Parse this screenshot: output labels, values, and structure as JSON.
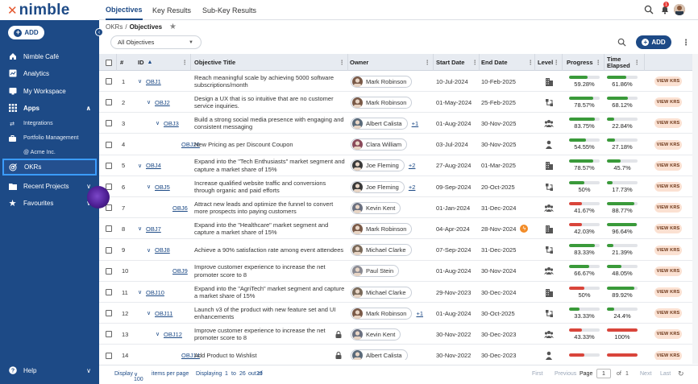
{
  "brand": {
    "name": "nimble"
  },
  "sidebar": {
    "add_label": "ADD",
    "items": [
      {
        "label": "Nimble Café"
      },
      {
        "label": "Analytics"
      },
      {
        "label": "My Workspace"
      },
      {
        "label": "Apps"
      }
    ],
    "apps": [
      {
        "label": "Integrations"
      },
      {
        "label": "Portfolio Management"
      },
      {
        "label": "@ Acme Inc."
      },
      {
        "label": "OKRs"
      }
    ],
    "recent": "Recent Projects",
    "favourites": "Favourites",
    "help": "Help"
  },
  "topbar": {
    "tabs": [
      {
        "label": "Objectives"
      },
      {
        "label": "Key Results"
      },
      {
        "label": "Sub-Key Results"
      }
    ],
    "notification_count": "1"
  },
  "breadcrumb": {
    "parent": "OKRs",
    "separator": "/",
    "current": "Objectives"
  },
  "toolbar": {
    "filter_value": "All Objectives",
    "add_label": "ADD"
  },
  "table": {
    "headers": {
      "num": "#",
      "id": "ID",
      "title": "Objective Title",
      "owner": "Owner",
      "start": "Start Date",
      "end": "End Date",
      "level": "Level",
      "progress": "Progress",
      "time": "Time Elapsed"
    },
    "action_label": "VIEW KRS",
    "rows": [
      {
        "num": "1",
        "id": "OBJ1",
        "indent": 1,
        "toggle": "∨",
        "title": "Reach meaningful scale by achieving 5000 software subscriptions/month",
        "owner": "Mark Robinson",
        "more": "",
        "start": "10-Jul-2024",
        "end": "10-Feb-2025",
        "level": "building",
        "progress": "59.28%",
        "progress_value": 0.5928,
        "progress_color": "#3a9a3a",
        "time": "61.86%",
        "time_value": 0.6186,
        "time_color": "#3a9a3a",
        "lock": false,
        "flame": false
      },
      {
        "num": "2",
        "id": "OBJ2",
        "indent": 2,
        "toggle": "∨",
        "title": "Design a UX that is so intuitive that are no customer service inquiries.",
        "owner": "Mark Robinson",
        "more": "",
        "start": "01-May-2024",
        "end": "25-Feb-2025",
        "level": "hierarchy",
        "progress": "78.57%",
        "progress_value": 0.7857,
        "progress_color": "#3a9a3a",
        "time": "68.12%",
        "time_value": 0.6812,
        "time_color": "#3a9a3a",
        "lock": false,
        "flame": false
      },
      {
        "num": "3",
        "id": "OBJ3",
        "indent": 3,
        "toggle": "∨",
        "title": "Build a strong social media presence with engaging and consistent messaging",
        "owner": "Albert Calista",
        "more": "+1",
        "start": "01-Aug-2024",
        "end": "30-Nov-2025",
        "level": "team",
        "progress": "83.75%",
        "progress_value": 0.8375,
        "progress_color": "#3a9a3a",
        "time": "22.84%",
        "time_value": 0.2284,
        "time_color": "#3a9a3a",
        "lock": false,
        "flame": false
      },
      {
        "num": "4",
        "id": "OBJ26",
        "indent": 4,
        "toggle": "",
        "title": "New Pricing as per Discount Coupon",
        "owner": "Clara William",
        "more": "",
        "start": "03-Jul-2024",
        "end": "30-Nov-2025",
        "level": "person",
        "progress": "54.55%",
        "progress_value": 0.5455,
        "progress_color": "#3a9a3a",
        "time": "27.18%",
        "time_value": 0.2718,
        "time_color": "#3a9a3a",
        "lock": false,
        "flame": false
      },
      {
        "num": "5",
        "id": "OBJ4",
        "indent": 1,
        "toggle": "∨",
        "title": "Expand into the \"Tech Enthusiasts\" market segment and capture a market share of 15%",
        "owner": "Joe Fleming",
        "more": "+2",
        "start": "27-Aug-2024",
        "end": "01-Mar-2025",
        "level": "building",
        "progress": "78.57%",
        "progress_value": 0.7857,
        "progress_color": "#3a9a3a",
        "time": "45.7%",
        "time_value": 0.457,
        "time_color": "#3a9a3a",
        "lock": false,
        "flame": false
      },
      {
        "num": "6",
        "id": "OBJ5",
        "indent": 2,
        "toggle": "∨",
        "title": "Increase qualified website traffic and conversions through organic and paid efforts",
        "owner": "Joe Fleming",
        "more": "+2",
        "start": "09-Sep-2024",
        "end": "20-Oct-2025",
        "level": "hierarchy",
        "progress": "50%",
        "progress_value": 0.5,
        "progress_color": "#3a9a3a",
        "time": "17.73%",
        "time_value": 0.1773,
        "time_color": "#3a9a3a",
        "lock": false,
        "flame": false
      },
      {
        "num": "7",
        "id": "OBJ6",
        "indent": 3,
        "toggle": "",
        "title": "Attract new leads and optimize the funnel to convert more prospects into paying customers",
        "owner": "Kevin Kent",
        "more": "",
        "start": "01-Jan-2024",
        "end": "31-Dec-2024",
        "level": "team",
        "progress": "41.67%",
        "progress_value": 0.4167,
        "progress_color": "#d9453b",
        "time": "88.77%",
        "time_value": 0.8877,
        "time_color": "#3a9a3a",
        "lock": false,
        "flame": false
      },
      {
        "num": "8",
        "id": "OBJ7",
        "indent": 1,
        "toggle": "∨",
        "title": "Expand into the \"Healthcare\" market segment and capture a market share of 15%",
        "owner": "Mark Robinson",
        "more": "",
        "start": "04-Apr-2024",
        "end": "28-Nov-2024",
        "level": "building",
        "progress": "42.03%",
        "progress_value": 0.4203,
        "progress_color": "#d9453b",
        "time": "96.64%",
        "time_value": 0.9664,
        "time_color": "#3a9a3a",
        "lock": false,
        "flame": true
      },
      {
        "num": "9",
        "id": "OBJ8",
        "indent": 2,
        "toggle": "∨",
        "title": "Achieve a 90% satisfaction rate among event attendees",
        "owner": "Michael Clarke",
        "more": "",
        "start": "07-Sep-2024",
        "end": "31-Dec-2025",
        "level": "hierarchy",
        "progress": "83.33%",
        "progress_value": 0.8333,
        "progress_color": "#3a9a3a",
        "time": "21.39%",
        "time_value": 0.2139,
        "time_color": "#3a9a3a",
        "lock": false,
        "flame": false
      },
      {
        "num": "10",
        "id": "OBJ9",
        "indent": 3,
        "toggle": "",
        "title": "Improve customer experience to increase the net promoter score to 8",
        "owner": "Paul Stein",
        "more": "",
        "start": "01-Aug-2024",
        "end": "30-Nov-2024",
        "level": "team",
        "progress": "66.67%",
        "progress_value": 0.6667,
        "progress_color": "#3a9a3a",
        "time": "48.05%",
        "time_value": 0.4805,
        "time_color": "#3a9a3a",
        "lock": false,
        "flame": false
      },
      {
        "num": "11",
        "id": "OBJ10",
        "indent": 1,
        "toggle": "∨",
        "title": "Expand into the \"AgriTech\" market segment and capture a market share of 15%",
        "owner": "Michael Clarke",
        "more": "",
        "start": "29-Nov-2023",
        "end": "30-Dec-2024",
        "level": "building",
        "progress": "50%",
        "progress_value": 0.5,
        "progress_color": "#d9453b",
        "time": "89.92%",
        "time_value": 0.8992,
        "time_color": "#3a9a3a",
        "lock": false,
        "flame": false
      },
      {
        "num": "12",
        "id": "OBJ11",
        "indent": 2,
        "toggle": "∨",
        "title": "Launch v3 of the product with new feature set and UI enhancements",
        "owner": "Mark Robinson",
        "more": "+1",
        "start": "01-Aug-2024",
        "end": "30-Oct-2025",
        "level": "hierarchy",
        "progress": "33.33%",
        "progress_value": 0.3333,
        "progress_color": "#3a9a3a",
        "time": "24.4%",
        "time_value": 0.244,
        "time_color": "#3a9a3a",
        "lock": false,
        "flame": false
      },
      {
        "num": "13",
        "id": "OBJ12",
        "indent": 3,
        "toggle": "∨",
        "title": "Improve customer experience to increase the net promoter score to 8",
        "owner": "Kevin Kent",
        "more": "",
        "start": "30-Nov-2022",
        "end": "30-Dec-2023",
        "level": "team",
        "progress": "43.33%",
        "progress_value": 0.4333,
        "progress_color": "#d9453b",
        "time": "100%",
        "time_value": 1.0,
        "time_color": "#d9453b",
        "lock": true,
        "flame": false
      },
      {
        "num": "14",
        "id": "OBJ14",
        "indent": 4,
        "toggle": "",
        "title": "Add Product to Wishlist",
        "owner": "Albert Calista",
        "more": "",
        "start": "30-Nov-2022",
        "end": "30-Dec-2023",
        "level": "person",
        "progress": "",
        "progress_value": 0.5,
        "progress_color": "#d9453b",
        "time": "",
        "time_value": 1.0,
        "time_color": "#d9453b",
        "lock": true,
        "flame": false
      }
    ]
  },
  "footer": {
    "display_label": "Display",
    "page_size": "100",
    "per_page_label": "items per page",
    "displaying_label": "Displaying",
    "range_start": "1",
    "range_to": "to",
    "range_end": "26",
    "out_of": "out of",
    "total": "26",
    "first": "First",
    "previous": "Previous",
    "page_label": "Page",
    "page_value": "1",
    "of_label": "of",
    "pages": "1",
    "next": "Next",
    "last": "Last"
  }
}
